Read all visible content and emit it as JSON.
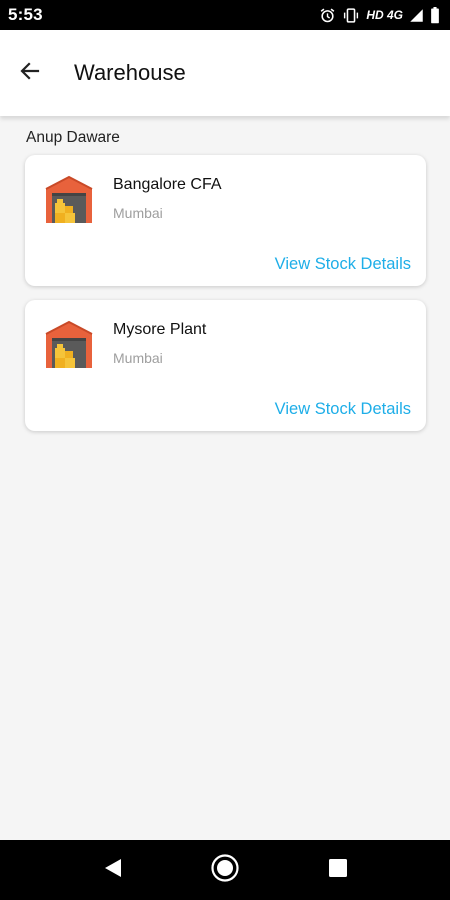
{
  "status_bar": {
    "time": "5:53",
    "network": "HD 4G",
    "icons": [
      "alarm-icon",
      "vibrate-icon",
      "signal-icon",
      "battery-icon"
    ]
  },
  "app_bar": {
    "title": "Warehouse",
    "back_icon": "arrow-left-icon"
  },
  "user": {
    "name": "Anup Daware"
  },
  "warehouses": [
    {
      "name": "Bangalore CFA",
      "location": "Mumbai",
      "action": "View Stock Details",
      "icon": "warehouse-icon"
    },
    {
      "name": "Mysore Plant",
      "location": "Mumbai",
      "action": "View Stock Details",
      "icon": "warehouse-icon"
    }
  ],
  "nav_bar": {
    "buttons": [
      "back-triangle-icon",
      "home-circle-icon",
      "recents-square-icon"
    ]
  },
  "colors": {
    "link": "#1eaee8",
    "warehouse_roof": "#e8623c",
    "warehouse_boxes": "#f5c43a",
    "background": "#f5f5f5"
  }
}
